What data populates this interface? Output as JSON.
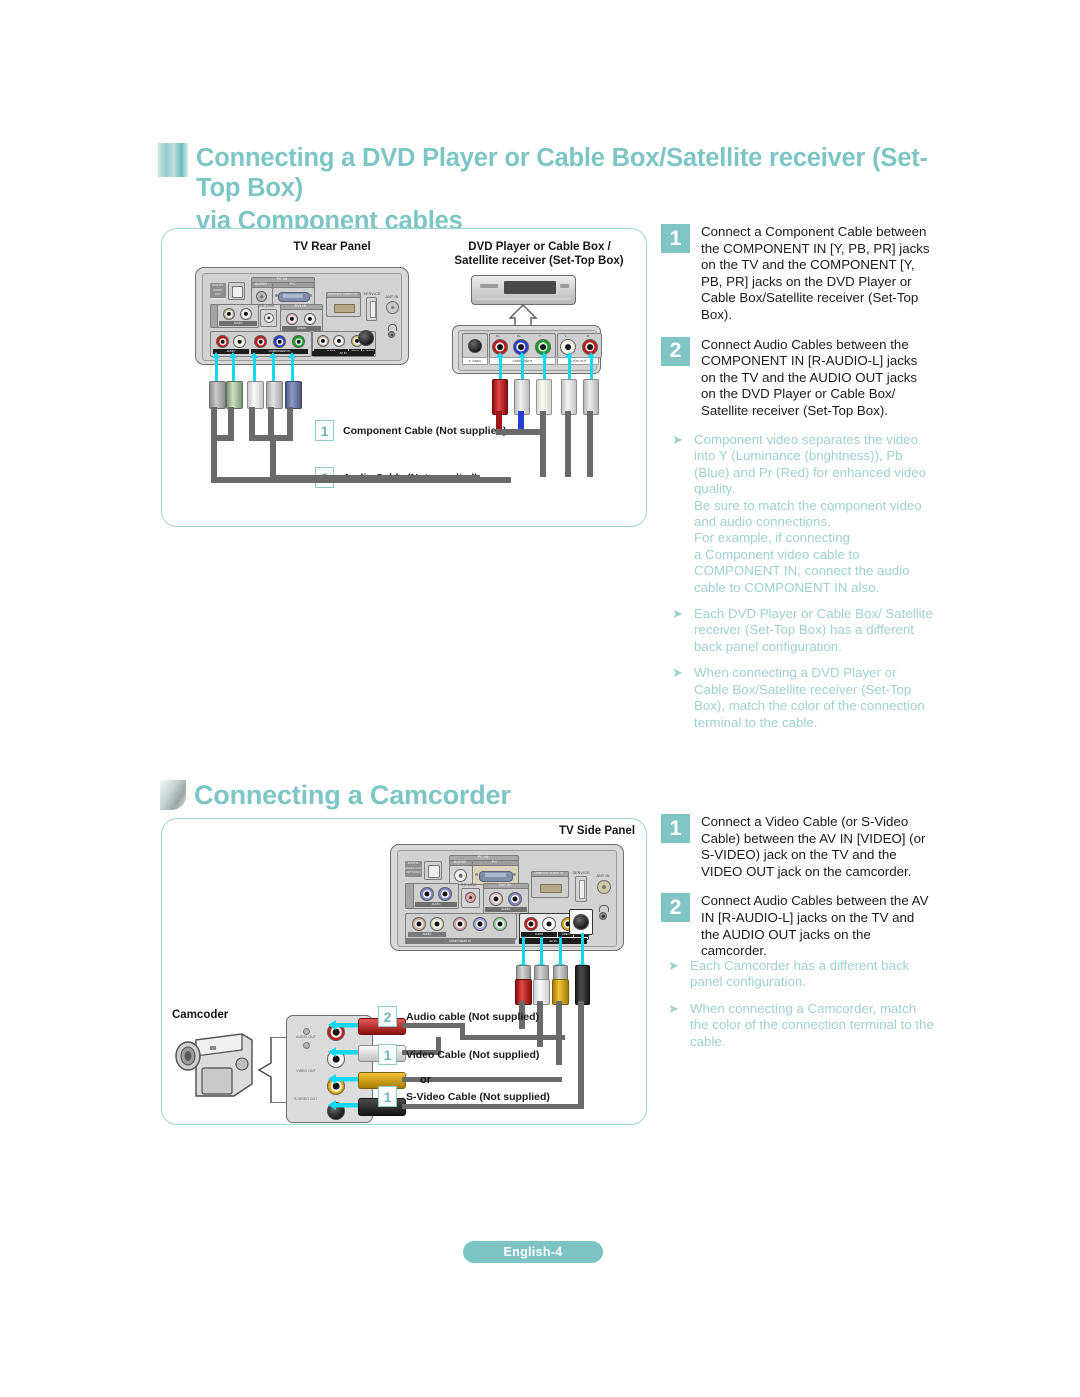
{
  "page": {
    "footer_label": "English-4"
  },
  "section1": {
    "title_line1": "Connecting a DVD Player or Cable Box/Satellite receiver (Set-Top Box)",
    "title_line2": "via Component cables",
    "diagram": {
      "caption_tv": "TV Rear Panel",
      "caption_dvd_line1": "DVD Player or Cable Box /",
      "caption_dvd_line2": "Satellite receiver (Set-Top Box)",
      "tv_panel": {
        "labels": {
          "digital_audio_out": "DIGITAL AUDIO OUT (OPTICAL)",
          "pc_in": "PC IN",
          "pc_in_audio": "AUDIO",
          "pc_in_pc": "PC",
          "hdmi_dvi_in": "HDMI/DVI IN",
          "service": "SERVICE",
          "ant_in": "ANT IN",
          "ex_link": "EX-LINK",
          "dvi_in": "DVI IN",
          "audio": "AUDIO",
          "component_in": "COMPONENT IN",
          "av_in": "AV IN",
          "video": "VIDEO",
          "s_video": "S-VIDEO",
          "hdmi_audio_in": "HDMI/DVI AUDIO IN"
        }
      },
      "dvd_panel": {
        "labels": {
          "s_video": "S-VIDEO",
          "component": "COMPONENT",
          "audio_out": "AUDIO OUT",
          "pr": "PR",
          "pb": "PB",
          "y": "Y",
          "l": "L",
          "r": "R"
        }
      },
      "callouts": [
        {
          "num": "1",
          "label": "Component Cable (Not supplied)"
        },
        {
          "num": "2",
          "label": "Audio Cable (Not supplied)"
        }
      ]
    },
    "steps": [
      {
        "num": "1",
        "text": "Connect a Component Cable between the COMPONENT IN [Y, PB, PR] jacks on the TV and the COMPONENT [Y, PB, PR] jacks on the DVD Player or Cable Box/Satellite receiver (Set-Top Box)."
      },
      {
        "num": "2",
        "text": "Connect Audio Cables between the COMPONENT IN [R-AUDIO-L] jacks on the TV and the AUDIO OUT jacks on the DVD Player or Cable Box/ Satellite receiver (Set-Top Box)."
      }
    ],
    "notes": [
      "Component video separates the video into Y (Luminance (brightness)), Pb (Blue) and Pr (Red) for enhanced video quality.\nBe sure to match the component video and audio connections.\nFor example, if connecting\na Component video cable to COMPONENT IN, connect the audio cable to COMPONENT IN also.",
      "Each DVD Player or Cable Box/ Satellite receiver (Set-Top Box) has a different back panel configuration.",
      "When connecting a DVD Player or Cable Box/Satellite receiver (Set-Top Box), match the color of the connection terminal to the cable."
    ]
  },
  "section2": {
    "title": "Connecting a Camcorder",
    "diagram": {
      "caption_tv_side": "TV Side Panel",
      "camcorder_label": "Camcoder",
      "camcorder_jacks": [
        "AUDIO OUT",
        "",
        "VIDEO OUT",
        "S-VIDEO OUT"
      ],
      "or_label": "or",
      "callouts": [
        {
          "num": "2",
          "label": "Audio cable (Not supplied)"
        },
        {
          "num": "1",
          "label": "Video Cable (Not supplied)"
        },
        {
          "num": "1",
          "label": "S-Video Cable (Not supplied)"
        }
      ]
    },
    "steps": [
      {
        "num": "1",
        "text": "Connect a Video Cable (or S-Video Cable) between the AV IN [VIDEO] (or S-VIDEO) jack on the TV and the VIDEO OUT jack on the camcorder."
      },
      {
        "num": "2",
        "text": "Connect Audio Cables between the AV IN [R-AUDIO-L] jacks on the TV and the AUDIO OUT jacks on the camcorder."
      }
    ],
    "notes": [
      "Each Camcorder has a different back panel configuration.",
      "When connecting a Camcorder, match the color of the connection terminal to the cable."
    ]
  },
  "colors": {
    "teal": "#7ec5c6",
    "teal_light": "#9ed1d3",
    "cyan_arrow": "#16d7f2",
    "jack_red": "#c21a1a",
    "jack_blue": "#2a3fd0",
    "jack_green": "#12a326",
    "jack_white": "#f2f2f2",
    "jack_yellow": "#e0a700"
  }
}
